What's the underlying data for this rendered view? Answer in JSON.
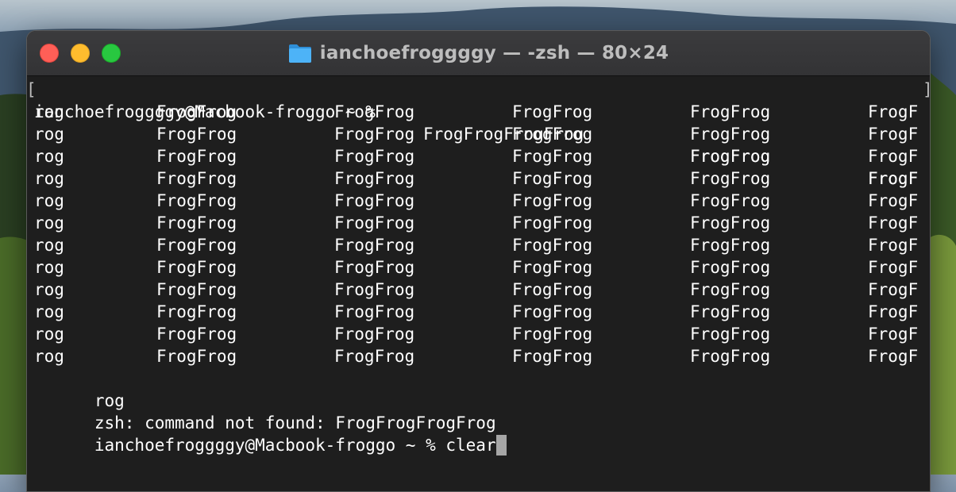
{
  "window": {
    "title": "ianchoefroggggy — -zsh — 80×24"
  },
  "icons": {
    "folder": "folder-icon",
    "close": "close-icon",
    "minimize": "minimize-icon",
    "zoom": "zoom-icon"
  },
  "colors": {
    "terminal_bg": "#1e1e1e",
    "text": "#ffffff",
    "close": "#ff5f57",
    "minimize": "#febc2e",
    "zoom": "#28c840",
    "folder": "#3fa9f5",
    "cursor": "#a6a6a6"
  },
  "terminal": {
    "first_line": {
      "prompt": "ianchoefroggggy@Macbook-froggo ~ % ",
      "cols": [
        "FrogFrogFrogFrog",
        "FrogFrog",
        "FrogF"
      ]
    },
    "grid_rows": [
      [
        "rog",
        "FrogFrog",
        "FrogFrog",
        "FrogFrog",
        "FrogFrog",
        "FrogF"
      ],
      [
        "rog",
        "FrogFrog",
        "FrogFrog",
        "FrogFrog",
        "FrogFrog",
        "FrogF"
      ],
      [
        "rog",
        "FrogFrog",
        "FrogFrog",
        "FrogFrog",
        "FrogFrog",
        "FrogF"
      ],
      [
        "rog",
        "FrogFrog",
        "FrogFrog",
        "FrogFrog",
        "FrogFrog",
        "FrogF"
      ],
      [
        "rog",
        "FrogFrog",
        "FrogFrog",
        "FrogFrog",
        "FrogFrog",
        "FrogF"
      ],
      [
        "rog",
        "FrogFrog",
        "FrogFrog",
        "FrogFrog",
        "FrogFrog",
        "FrogF"
      ],
      [
        "rog",
        "FrogFrog",
        "FrogFrog",
        "FrogFrog",
        "FrogFrog",
        "FrogF"
      ],
      [
        "rog",
        "FrogFrog",
        "FrogFrog",
        "FrogFrog",
        "FrogFrog",
        "FrogF"
      ],
      [
        "rog",
        "FrogFrog",
        "FrogFrog",
        "FrogFrog",
        "FrogFrog",
        "FrogF"
      ],
      [
        "rog",
        "FrogFrog",
        "FrogFrog",
        "FrogFrog",
        "FrogFrog",
        "FrogF"
      ],
      [
        "rog",
        "FrogFrog",
        "FrogFrog",
        "FrogFrog",
        "FrogFrog",
        "FrogF"
      ],
      [
        "rog",
        "FrogFrog",
        "FrogFrog",
        "FrogFrog",
        "FrogFrog",
        "FrogF"
      ]
    ],
    "tail_line": "rog",
    "error_line": "zsh: command not found: FrogFrogFrogFrog",
    "last_prompt": "ianchoefroggggy@Macbook-froggo ~ % ",
    "last_command": "clear"
  }
}
